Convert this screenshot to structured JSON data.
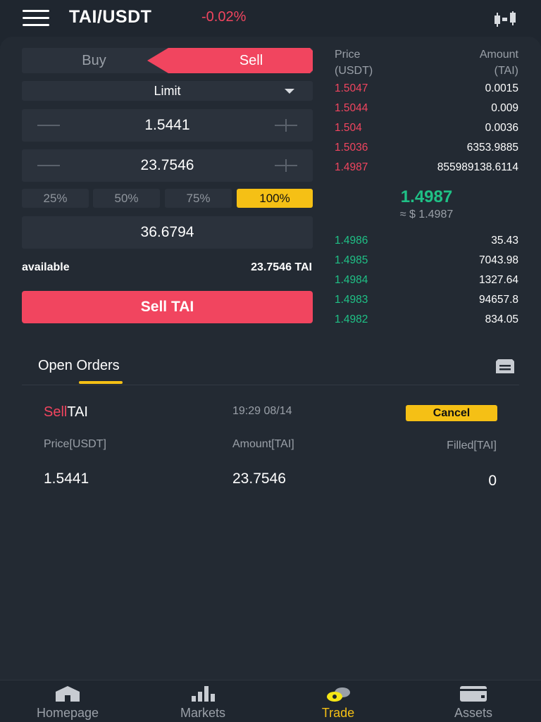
{
  "header": {
    "pair": "TAI/USDT",
    "change": "-0.02%",
    "icons": {
      "menu": "menu-icon",
      "chart": "candlestick-chart-icon"
    }
  },
  "trade_form": {
    "tabs": {
      "buy": "Buy",
      "sell": "Sell",
      "active": "Sell"
    },
    "order_type": "Limit",
    "price_value": "1.5441",
    "amount_value": "23.7546",
    "percent_options": [
      "25%",
      "50%",
      "75%",
      "100%"
    ],
    "active_percent": "100%",
    "total_value": "36.6794",
    "available_label": "available",
    "available_value": "23.7546 TAI",
    "submit_label": "Sell TAI"
  },
  "orderbook": {
    "price_header": [
      "Price",
      "(USDT)"
    ],
    "amount_header": [
      "Amount",
      "(TAI)"
    ],
    "asks": [
      {
        "price": "1.5047",
        "amount": "0.0015"
      },
      {
        "price": "1.5044",
        "amount": "0.009"
      },
      {
        "price": "1.504",
        "amount": "0.0036"
      },
      {
        "price": "1.5036",
        "amount": "6353.9885"
      },
      {
        "price": "1.4987",
        "amount": "855989138.6114"
      }
    ],
    "last_price": "1.4987",
    "last_price_usd": "≈ $ 1.4987",
    "bids": [
      {
        "price": "1.4986",
        "amount": "35.43"
      },
      {
        "price": "1.4985",
        "amount": "7043.98"
      },
      {
        "price": "1.4984",
        "amount": "1327.64"
      },
      {
        "price": "1.4983",
        "amount": "94657.8"
      },
      {
        "price": "1.4982",
        "amount": "834.05"
      }
    ]
  },
  "open_orders": {
    "title": "Open Orders",
    "orders": [
      {
        "side": "Sell",
        "asset": "TAI",
        "time": "19:29 08/14",
        "cancel_label": "Cancel",
        "price_label": "Price[USDT]",
        "amount_label": "Amount[TAI]",
        "filled_label": "Filled[TAI]",
        "price": "1.5441",
        "amount": "23.7546",
        "filled": "0"
      }
    ]
  },
  "bottom_nav": {
    "items": [
      {
        "label": "Homepage",
        "icon": "home-icon"
      },
      {
        "label": "Markets",
        "icon": "bar-chart-icon"
      },
      {
        "label": "Trade",
        "icon": "trade-coins-icon"
      },
      {
        "label": "Assets",
        "icon": "wallet-icon"
      }
    ],
    "active": "Trade"
  },
  "colors": {
    "sell": "#f1455f",
    "buy": "#1fc186",
    "accent": "#f5c015",
    "background": "#1f262f"
  }
}
